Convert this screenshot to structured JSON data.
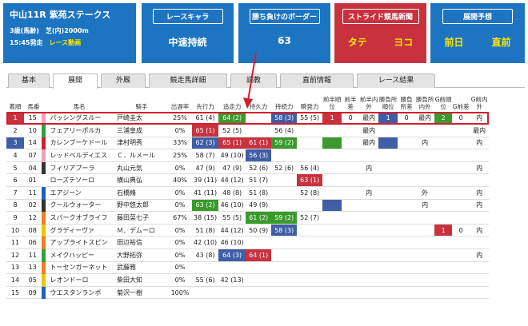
{
  "race": {
    "title": "中山11R 紫苑ステークス",
    "cond": "3歳(馬齢)　芝(内)2000m",
    "time": "15:45発走",
    "video": "レース動画"
  },
  "boxes": {
    "chara": {
      "head": "レースキャラ",
      "value": "中速持続"
    },
    "border": {
      "head": "勝ち負けのボーダー",
      "value": "63"
    },
    "stride": {
      "head": "ストライド競馬新聞",
      "a": "タテ",
      "b": "ヨコ"
    },
    "tenkai": {
      "head": "展開予想",
      "a": "前日",
      "b": "直前"
    }
  },
  "tabs": [
    "基本",
    "展開",
    "外厩",
    "競走馬詳細",
    "調教",
    "直前情報",
    "レース結果"
  ],
  "headers": [
    "着順",
    "馬番",
    "馬名",
    "騎手",
    "出遅率",
    "先行力",
    "追走力",
    "持久力",
    "持続力",
    "瞬発力",
    "前半順位",
    "前半差",
    "前半内外",
    "勝負所順位",
    "勝負所差",
    "勝負所内外",
    "G前順位",
    "G前差",
    "G前内外"
  ],
  "rows": [
    [
      "1",
      "15",
      "パッシングスルー",
      "戸崎圭太",
      "25%",
      "61 (4)",
      "64 (2)",
      "",
      "58 (3)",
      "55 (5)",
      "1",
      "0",
      "最内",
      "1",
      "0",
      "最内",
      "2",
      "0",
      "内"
    ],
    [
      "2",
      "10",
      "フェアリーポルカ",
      "三浦皇成",
      "0%",
      "65 (1)",
      "52 (5)",
      "",
      "56 (4)",
      "",
      "",
      "",
      "最内",
      "",
      "",
      "",
      "",
      "",
      "最内"
    ],
    [
      "3",
      "14",
      "カレンブーケドール",
      "津村明秀",
      "33%",
      "62 (3)",
      "65 (1)",
      "61 (1)",
      "59 (2)",
      "",
      "",
      "",
      "最内",
      "",
      "",
      "内",
      "",
      "",
      "内"
    ],
    [
      "4",
      "07",
      "レッドベルディエス",
      "Ｃ．ルメール",
      "25%",
      "58 (7)",
      "49 (10)",
      "56 (3)",
      "",
      "",
      "",
      "",
      "",
      "",
      "",
      "",
      "",
      "",
      ""
    ],
    [
      "5",
      "04",
      "フィリアプーラ",
      "丸山元気",
      "0%",
      "47 (9)",
      "47 (9)",
      "52 (6)",
      "52 (6)",
      "56 (4)",
      "",
      "",
      "内",
      "",
      "",
      "",
      "",
      "",
      "内"
    ],
    [
      "6",
      "01",
      "ローズテソーロ",
      "横山典弘",
      "40%",
      "39 (11)",
      "44 (12)",
      "51 (7)",
      "",
      "63 (1)",
      "",
      "",
      "",
      "",
      "",
      "",
      "",
      "",
      ""
    ],
    [
      "7",
      "11",
      "エアジーン",
      "石橋脩",
      "0%",
      "41 (11)",
      "48 (8)",
      "51 (8)",
      "",
      "52 (8)",
      "",
      "",
      "内",
      "",
      "",
      "外",
      "",
      "",
      "内"
    ],
    [
      "8",
      "02",
      "クールウォーター",
      "野中悠太郎",
      "0%",
      "63 (2)",
      "46 (10)",
      "49 (9)",
      "",
      "",
      "",
      "",
      "",
      "",
      "",
      "内",
      "",
      "",
      "内"
    ],
    [
      "9",
      "12",
      "スパークオブライフ",
      "藤田菜七子",
      "67%",
      "38 (15)",
      "55 (5)",
      "61 (2)",
      "59 (2)",
      "52 (7)",
      "",
      "",
      "",
      "",
      "",
      "",
      "",
      "",
      ""
    ],
    [
      "10",
      "08",
      "グラディーヴァ",
      "Ｍ．デムーロ",
      "0%",
      "51 (8)",
      "44 (12)",
      "50 (9)",
      "58 (3)",
      "",
      "",
      "",
      "",
      "",
      "",
      "",
      "1",
      "0",
      "内"
    ],
    [
      "11",
      "06",
      "アップライトスピン",
      "田辺裕信",
      "0%",
      "42 (10)",
      "46 (10)",
      "",
      "",
      "",
      "",
      "",
      "",
      "",
      "",
      "",
      "",
      "",
      ""
    ],
    [
      "12",
      "11",
      "メイクハッピー",
      "大野拓弥",
      "0%",
      "43 (8)",
      "64 (3)",
      "64 (1)",
      "",
      "",
      "",
      "",
      "",
      "",
      "",
      "",
      "",
      "",
      "内"
    ],
    [
      "13",
      "13",
      "トーセンガーネット",
      "武藤雅",
      "0%",
      "",
      "",
      "",
      "",
      "",
      "",
      "",
      "",
      "",
      "",
      "",
      "",
      "",
      ""
    ],
    [
      "14",
      "05",
      "レオンドーロ",
      "柴田大知",
      "0%",
      "55 (6)",
      "42 (13)",
      "",
      "",
      "",
      "",
      "",
      "",
      "",
      "",
      "",
      "",
      "",
      ""
    ],
    [
      "15",
      "09",
      "ウエスタンランボ",
      "菊沢一樹",
      "100%",
      "",
      "",
      "",
      "",
      "",
      "",
      "",
      "",
      "",
      "",
      "",
      "",
      "",
      ""
    ]
  ],
  "colors": {
    "red": "#c8323f",
    "blue": "#3f5ea6",
    "green": "#3a9a2c",
    "header_blue": "#1d75c2"
  }
}
